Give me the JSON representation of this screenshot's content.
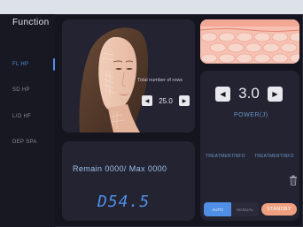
{
  "sidebar": {
    "title": "Function",
    "items": [
      {
        "label": "FL HP",
        "active": true
      },
      {
        "label": "SD HP",
        "active": false
      },
      {
        "label": "L/O HF",
        "active": false
      },
      {
        "label": "DEP SPA",
        "active": false
      }
    ]
  },
  "face_panel": {
    "rows_label": "Total number of rows",
    "rows_value": "25.0",
    "decrement_icon": "triangle-left-icon",
    "increment_icon": "triangle-right-icon"
  },
  "remain_panel": {
    "text": "Remain 0000/ Max 0000",
    "counter": "D54.5"
  },
  "power_panel": {
    "value": "3.0",
    "label": "POWER(J)",
    "treatment_left": "TREATMENTINFO",
    "treatment_right": "TREATMENTINFO",
    "trash_icon": "trash-icon"
  },
  "controls": {
    "auto_label": "AUTO",
    "manual_label": "MANUAL",
    "standby_label": "STANDBY"
  },
  "colors": {
    "accent": "#4f8fe6",
    "standby": "#f0a080",
    "background": "#15151f"
  }
}
